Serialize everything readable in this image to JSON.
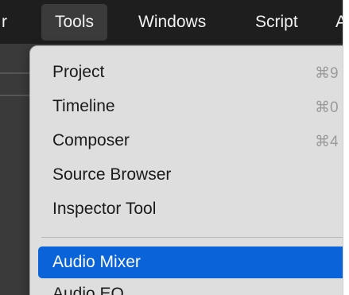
{
  "menubar": {
    "items": [
      {
        "label": "r"
      },
      {
        "label": "Tools"
      },
      {
        "label": "Windows"
      },
      {
        "label": "Script"
      },
      {
        "label": "A"
      }
    ]
  },
  "dropdown": {
    "items": [
      {
        "label": "Project",
        "shortcut": "⌘9"
      },
      {
        "label": "Timeline",
        "shortcut": "⌘0"
      },
      {
        "label": "Composer",
        "shortcut": "⌘4"
      },
      {
        "label": "Source Browser",
        "shortcut": ""
      },
      {
        "label": "Inspector Tool",
        "shortcut": ""
      }
    ],
    "highlighted": {
      "label": "Audio Mixer"
    },
    "partial": {
      "label": "Audio EQ"
    }
  },
  "colors": {
    "highlight": "#0a63d8",
    "menubar": "#1e1e1e"
  }
}
